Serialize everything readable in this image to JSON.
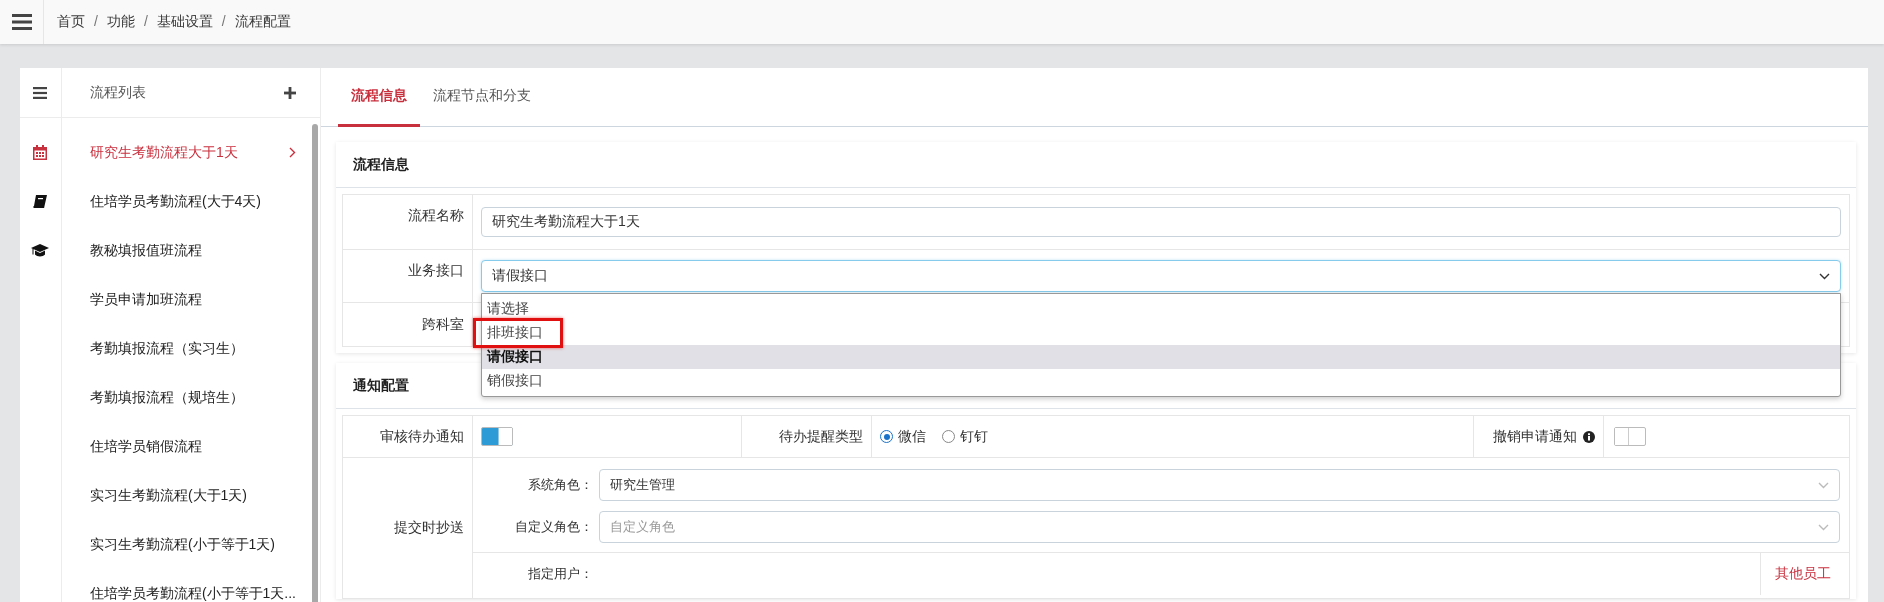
{
  "topbar": {
    "breadcrumb": [
      {
        "kind": "crumb",
        "text": "首页"
      },
      {
        "kind": "separator",
        "text": "/"
      },
      {
        "kind": "crumb",
        "text": "功能"
      },
      {
        "kind": "separator",
        "text": "/"
      },
      {
        "kind": "crumb",
        "text": "基础设置"
      },
      {
        "kind": "separator",
        "text": "/"
      },
      {
        "kind": "crumb",
        "text": "流程配置"
      }
    ]
  },
  "sidebar": {
    "title": "流程列表",
    "items": [
      {
        "label": "研究生考勤流程大于1天",
        "selected": true
      },
      {
        "label": "住培学员考勤流程(大于4天)",
        "selected": false
      },
      {
        "label": "教秘填报值班流程",
        "selected": false
      },
      {
        "label": "学员申请加班流程",
        "selected": false
      },
      {
        "label": "考勤填报流程（实习生）",
        "selected": false
      },
      {
        "label": "考勤填报流程（规培生）",
        "selected": false
      },
      {
        "label": "住培学员销假流程",
        "selected": false
      },
      {
        "label": "实习生考勤流程(大于1天)",
        "selected": false
      },
      {
        "label": "实习生考勤流程(小于等于1天)",
        "selected": false
      },
      {
        "label": "住培学员考勤流程(小于等于1天...",
        "selected": false
      }
    ]
  },
  "tabs": [
    {
      "label": "流程信息",
      "selected": true
    },
    {
      "label": "流程节点和分支",
      "selected": false
    }
  ],
  "process_info": {
    "title": "流程信息",
    "fields": [
      {
        "kind": "text",
        "label": "流程名称",
        "value": "研究生考勤流程大于1天"
      },
      {
        "kind": "select",
        "label": "业务接口",
        "value": "请假接口",
        "open": true
      },
      {
        "kind": "blank",
        "label": "跨科室"
      }
    ],
    "dropdown": {
      "options": [
        {
          "label": "请选择",
          "selected": false,
          "highlighted": false
        },
        {
          "label": "排班接口",
          "selected": false,
          "highlighted": true
        },
        {
          "label": "请假接口",
          "selected": true,
          "highlighted": false
        },
        {
          "label": "销假接口",
          "selected": false,
          "highlighted": false
        }
      ]
    }
  },
  "notify": {
    "title": "通知配置",
    "review_notice": {
      "label": "审核待办通知",
      "on": true
    },
    "reminder_type": {
      "label": "待办提醒类型",
      "options": [
        {
          "label": "微信",
          "selected": true
        },
        {
          "label": "钉钉",
          "selected": false
        }
      ]
    },
    "revoke_notice": {
      "label": "撤销申请通知",
      "on": false
    },
    "cc": {
      "label": "提交时抄送",
      "system_role": {
        "label": "系统角色：",
        "value": "研究生管理"
      },
      "custom_role": {
        "label": "自定义角色：",
        "placeholder": "自定义角色"
      },
      "user": {
        "label": "指定用户：",
        "link": "其他员工"
      }
    }
  }
}
